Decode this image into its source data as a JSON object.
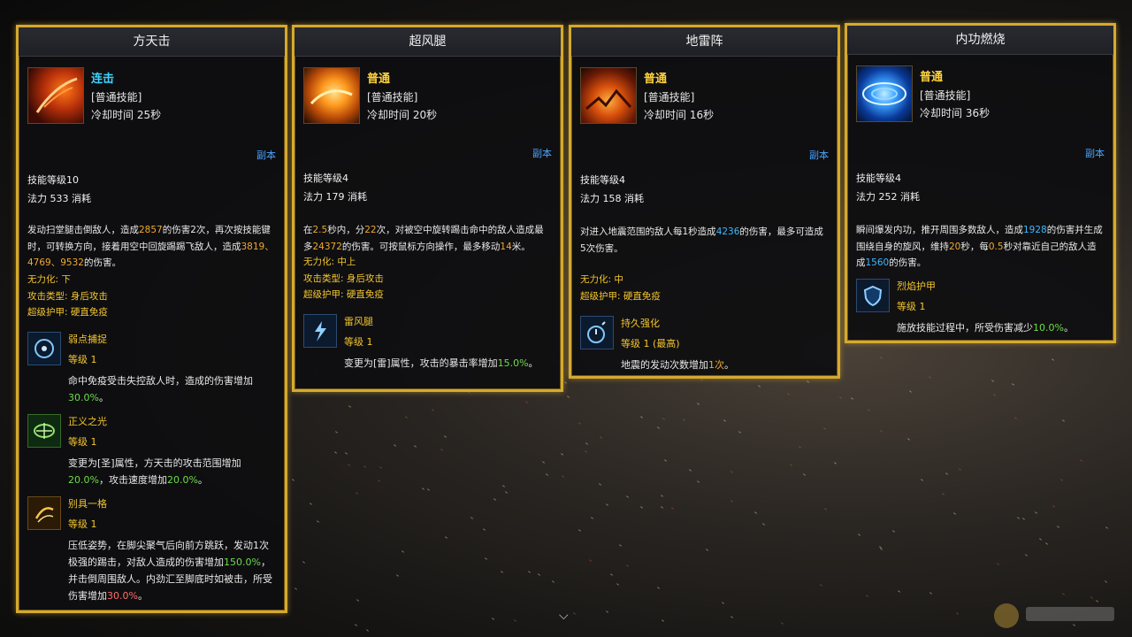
{
  "cards": [
    {
      "title": "方天击",
      "type_label": "连击",
      "category": "[普通技能]",
      "cooldown": "冷却时间 25秒",
      "mode_link": "副本",
      "skill_level": "技能等级10",
      "mana_cost": "法力 533 消耗",
      "desc": [
        "发动扫堂腿击倒敌人，造成",
        "2857",
        "的伤害2次，再次按技能键时，可转换方向，接着用空中回旋踢踢飞敌人，造成",
        "3819、4769、9532",
        "的伤害。"
      ],
      "props": [
        "无力化: 下",
        "攻击类型: 身后攻击",
        "超级护甲: 硬直免疫"
      ],
      "runes": [
        {
          "name": "弱点捕捉",
          "level": "等级 1",
          "text": [
            "命中免疫受击失控敌人时，造成的伤害增加",
            "30.0%",
            "。"
          ]
        },
        {
          "name": "正义之光",
          "level": "等级 1",
          "text": [
            "变更为[圣]属性，方天击的攻击范围增加",
            "20.0%",
            "，攻击速度增加",
            "20.0%",
            "。"
          ]
        },
        {
          "name": "别具一格",
          "level": "等级 1",
          "text": [
            "压低姿势，在脚尖聚气后向前方跳跃，发动1次极强的踢击，对敌人造成的伤害增加",
            "150.0%",
            "，并击倒周围敌人。内劲汇至脚底时如被击，所受伤害增加",
            "30.0%",
            "。"
          ]
        }
      ]
    },
    {
      "title": "超风腿",
      "type_label": "普通",
      "category": "[普通技能]",
      "cooldown": "冷却时间 20秒",
      "mode_link": "副本",
      "skill_level": "技能等级4",
      "mana_cost": "法力 179 消耗",
      "desc": [
        "在",
        "2.5",
        "秒内，分",
        "22",
        "次，对被空中旋转踢击命中的敌人造成最多",
        "24372",
        "的伤害。可按鼠标方向操作，最多移动",
        "14",
        "米。"
      ],
      "props": [
        "无力化: 中上",
        "攻击类型: 身后攻击",
        "超级护甲: 硬直免疫"
      ],
      "runes": [
        {
          "name": "雷风腿",
          "level": "等级 1",
          "text": [
            "变更为[雷]属性，攻击的暴击率增加",
            "15.0%",
            "。"
          ]
        }
      ]
    },
    {
      "title": "地雷阵",
      "type_label": "普通",
      "category": "[普通技能]",
      "cooldown": "冷却时间 16秒",
      "mode_link": "副本",
      "skill_level": "技能等级4",
      "mana_cost": "法力 158 消耗",
      "desc": [
        "对进入地震范围的敌人每1秒造成",
        "4236",
        "的伤害，最多可造成5次伤害。"
      ],
      "props": [
        "无力化: 中",
        "超级护甲: 硬直免疫"
      ],
      "runes": [
        {
          "name": "持久强化",
          "level": "等级 1 (最高)",
          "text": [
            "地震的发动次数增加",
            "1次",
            "。"
          ]
        }
      ]
    },
    {
      "title": "内功燃烧",
      "type_label": "普通",
      "category": "[普通技能]",
      "cooldown": "冷却时间 36秒",
      "mode_link": "副本",
      "skill_level": "技能等级4",
      "mana_cost": "法力 252 消耗",
      "desc": [
        "瞬间爆发内功，推开周围多数敌人，造成",
        "1928",
        "的伤害并生成围绕自身的旋风，维持",
        "20",
        "秒，每",
        "0.5",
        "秒对靠近自己的敌人造成",
        "1560",
        "的伤害。"
      ],
      "props": [],
      "runes": [
        {
          "name": "烈焰护甲",
          "level": "等级 1",
          "text": [
            "施放技能过程中，所受伤害减少",
            "10.0%",
            "。"
          ]
        }
      ]
    }
  ],
  "colors": {
    "border": "#d6a92e",
    "cyan": "#3fd3ff",
    "yellow": "#ffd23a",
    "orange": "#f0a830",
    "blue": "#3fb8ff",
    "green": "#6ddc4a",
    "red": "#ff6b6b",
    "link": "#4aa3ff"
  },
  "icons": {
    "scroll": "chevron-down-icon"
  }
}
